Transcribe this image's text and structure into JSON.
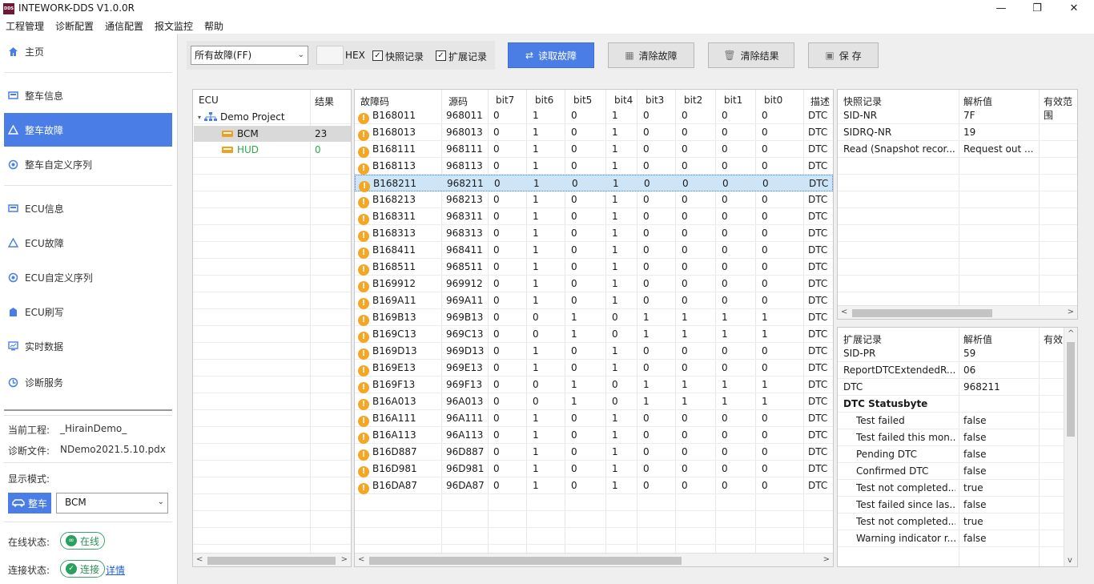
{
  "app": {
    "title": "INTEWORK-DDS V1.0.0R",
    "logo": "DDS",
    "win_min": "—",
    "win_max": "❐",
    "win_close": "✕"
  },
  "menu": [
    "工程管理",
    "诊断配置",
    "通信配置",
    "报文监控",
    "帮助"
  ],
  "sidebar": {
    "items": [
      {
        "label": "主页",
        "icon": "home-icon"
      },
      {
        "label": "整车信息",
        "icon": "vehicle-info-icon"
      },
      {
        "label": "整车故障",
        "icon": "warning-icon"
      },
      {
        "label": "整车自定义序列",
        "icon": "sequence-icon"
      },
      {
        "label": "ECU信息",
        "icon": "ecu-info-icon"
      },
      {
        "label": "ECU故障",
        "icon": "warning-icon"
      },
      {
        "label": "ECU自定义序列",
        "icon": "sequence-icon"
      },
      {
        "label": "ECU刷写",
        "icon": "flash-icon"
      },
      {
        "label": "实时数据",
        "icon": "monitor-icon"
      },
      {
        "label": "诊断服务",
        "icon": "service-icon"
      }
    ],
    "project_label": "当前工程:",
    "project_value": "_HirainDemo_",
    "file_label": "诊断文件:",
    "file_value": "NDemo2021.5.10.pdx",
    "mode_label": "显示模式:",
    "mode_button": "整车",
    "mode_select": "BCM",
    "online_label": "在线状态:",
    "online_value": "在线",
    "conn_label": "连接状态:",
    "conn_value": "连接",
    "conn_detail": "详情"
  },
  "toolbar": {
    "filter": "所有故障(FF)",
    "hex_label": "HEX",
    "snapshot_label": "快照记录",
    "extended_label": "扩展记录",
    "read_button": "读取故障",
    "clear_dtc_button": "清除故障",
    "clear_result_button": "清除结果",
    "save_button": "保 存"
  },
  "ecu_tree": {
    "col_ecu": "ECU",
    "col_result": "结果",
    "root": "Demo Project",
    "nodes": [
      {
        "name": "BCM",
        "result": "23"
      },
      {
        "name": "HUD",
        "result": "0"
      }
    ]
  },
  "dtc_table": {
    "headers": [
      "故障码",
      "源码",
      "bit7",
      "bit6",
      "bit5",
      "bit4",
      "bit3",
      "bit2",
      "bit1",
      "bit0",
      "描述"
    ],
    "rows": [
      [
        "B168011",
        "968011",
        "0",
        "1",
        "0",
        "1",
        "0",
        "0",
        "0",
        "0",
        "DTC"
      ],
      [
        "B168013",
        "968013",
        "0",
        "1",
        "0",
        "1",
        "0",
        "0",
        "0",
        "0",
        "DTC"
      ],
      [
        "B168111",
        "968111",
        "0",
        "1",
        "0",
        "1",
        "0",
        "0",
        "0",
        "0",
        "DTC"
      ],
      [
        "B168113",
        "968113",
        "0",
        "1",
        "0",
        "1",
        "0",
        "0",
        "0",
        "0",
        "DTC"
      ],
      [
        "B168211",
        "968211",
        "0",
        "1",
        "0",
        "1",
        "0",
        "0",
        "0",
        "0",
        "DTC"
      ],
      [
        "B168213",
        "968213",
        "0",
        "1",
        "0",
        "1",
        "0",
        "0",
        "0",
        "0",
        "DTC"
      ],
      [
        "B168311",
        "968311",
        "0",
        "1",
        "0",
        "1",
        "0",
        "0",
        "0",
        "0",
        "DTC"
      ],
      [
        "B168313",
        "968313",
        "0",
        "1",
        "0",
        "1",
        "0",
        "0",
        "0",
        "0",
        "DTC"
      ],
      [
        "B168411",
        "968411",
        "0",
        "1",
        "0",
        "1",
        "0",
        "0",
        "0",
        "0",
        "DTC"
      ],
      [
        "B168511",
        "968511",
        "0",
        "1",
        "0",
        "1",
        "0",
        "0",
        "0",
        "0",
        "DTC"
      ],
      [
        "B169912",
        "969912",
        "0",
        "1",
        "0",
        "1",
        "0",
        "0",
        "0",
        "0",
        "DTC"
      ],
      [
        "B169A11",
        "969A11",
        "0",
        "1",
        "0",
        "1",
        "0",
        "0",
        "0",
        "0",
        "DTC"
      ],
      [
        "B169B13",
        "969B13",
        "0",
        "0",
        "1",
        "0",
        "1",
        "1",
        "1",
        "1",
        "DTC"
      ],
      [
        "B169C13",
        "969C13",
        "0",
        "0",
        "1",
        "0",
        "1",
        "1",
        "1",
        "1",
        "DTC"
      ],
      [
        "B169D13",
        "969D13",
        "0",
        "1",
        "0",
        "1",
        "0",
        "0",
        "0",
        "0",
        "DTC"
      ],
      [
        "B169E13",
        "969E13",
        "0",
        "1",
        "0",
        "1",
        "0",
        "0",
        "0",
        "0",
        "DTC"
      ],
      [
        "B169F13",
        "969F13",
        "0",
        "0",
        "1",
        "0",
        "1",
        "1",
        "1",
        "1",
        "DTC"
      ],
      [
        "B16A013",
        "96A013",
        "0",
        "0",
        "1",
        "0",
        "1",
        "1",
        "1",
        "1",
        "DTC"
      ],
      [
        "B16A111",
        "96A111",
        "0",
        "1",
        "0",
        "1",
        "0",
        "0",
        "0",
        "0",
        "DTC"
      ],
      [
        "B16A113",
        "96A113",
        "0",
        "1",
        "0",
        "1",
        "0",
        "0",
        "0",
        "0",
        "DTC"
      ],
      [
        "B16D887",
        "96D887",
        "0",
        "1",
        "0",
        "1",
        "0",
        "0",
        "0",
        "0",
        "DTC"
      ],
      [
        "B16D981",
        "96D981",
        "0",
        "1",
        "0",
        "1",
        "0",
        "0",
        "0",
        "0",
        "DTC"
      ],
      [
        "B16DA87",
        "96DA87",
        "0",
        "1",
        "0",
        "1",
        "0",
        "0",
        "0",
        "0",
        "DTC"
      ]
    ],
    "selected_index": 4
  },
  "snapshot": {
    "headers": [
      "快照记录",
      "解析值",
      "有效范围"
    ],
    "rows": [
      [
        "SID-NR",
        "7F"
      ],
      [
        "SIDRQ-NR",
        "19"
      ],
      [
        "Read (Snapshot recor...",
        "Request out ..."
      ]
    ]
  },
  "extended": {
    "headers": [
      "扩展记录",
      "解析值",
      "有效"
    ],
    "rows": [
      [
        "SID-PR",
        "59",
        false
      ],
      [
        "ReportDTCExtendedR...",
        "06",
        false
      ],
      [
        "DTC",
        "968211",
        false
      ],
      [
        "DTC Statusbyte",
        "",
        true
      ],
      [
        "Test failed",
        "false",
        false
      ],
      [
        "Test failed this mon...",
        "false",
        false
      ],
      [
        "Pending DTC",
        "false",
        false
      ],
      [
        "Confirmed DTC",
        "false",
        false
      ],
      [
        "Test not completed...",
        "true",
        false
      ],
      [
        "Test failed since las...",
        "false",
        false
      ],
      [
        "Test not completed...",
        "true",
        false
      ],
      [
        "Warning indicator r...",
        "false",
        false
      ]
    ]
  },
  "colors": {
    "accent": "#4a7ee6",
    "selected_row": "#cde6f7",
    "warn": "#f5a623",
    "ok": "#2a9f5f",
    "hud": "#2ea84d"
  }
}
